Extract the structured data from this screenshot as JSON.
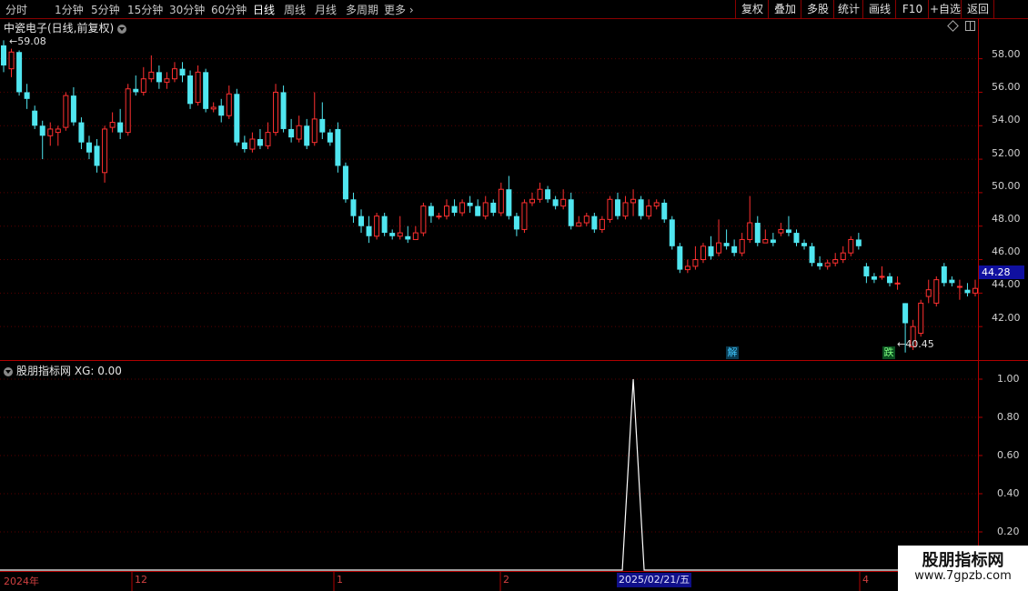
{
  "toolbar": {
    "periods": [
      "分时",
      "1分钟",
      "5分钟",
      "15分钟",
      "30分钟",
      "60分钟",
      "日线",
      "周线",
      "月线",
      "多周期",
      "更多"
    ],
    "active_period": "日线",
    "right_buttons": [
      "复权",
      "叠加",
      "多股",
      "统计",
      "画线",
      "F10",
      "+自选",
      "返回"
    ]
  },
  "main_chart": {
    "title": "中瓷电子(日线,前复权)",
    "high_label": "59.08",
    "low_label": "40.45",
    "last_price": "44.28",
    "y_ticks": [
      "58.00",
      "56.00",
      "54.00",
      "52.00",
      "50.00",
      "48.00",
      "46.00",
      "44.00",
      "42.00"
    ],
    "signals": [
      {
        "text": "解",
        "color": "#40c8ff"
      },
      {
        "text": "跌",
        "color": "#40ff80"
      }
    ]
  },
  "indicator": {
    "title": "股朋指标网",
    "value_text": "XG: 0.00",
    "y_ticks": [
      "1.00",
      "0.80",
      "0.60",
      "0.40",
      "0.20"
    ]
  },
  "x_axis": {
    "labels": [
      "2024年",
      "12",
      "1",
      "2",
      "4"
    ],
    "cursor_date": "2025/02/21/五"
  },
  "watermark": {
    "line1": "股朋指标网",
    "line2": "www.7gpzb.com"
  },
  "colors": {
    "up": "#ff3030",
    "down": "#50e6f0",
    "grid": "#5a0000",
    "border": "#b00000"
  },
  "chart_data": {
    "type": "candlestick",
    "ylim": [
      40,
      59.5
    ],
    "candles": [
      [
        58.8,
        57.6,
        59.1,
        57.2
      ],
      [
        57.4,
        58.4,
        58.6,
        56.9
      ],
      [
        58.4,
        56.0,
        58.5,
        55.8
      ],
      [
        56.0,
        55.6,
        56.5,
        55.0
      ],
      [
        54.9,
        54.0,
        55.2,
        53.8
      ],
      [
        54.0,
        53.4,
        54.3,
        52.0
      ],
      [
        53.4,
        53.8,
        54.2,
        52.8
      ],
      [
        53.6,
        53.8,
        54.0,
        52.8
      ],
      [
        53.9,
        55.8,
        56.0,
        53.7
      ],
      [
        55.8,
        54.2,
        56.3,
        54.0
      ],
      [
        54.2,
        53.0,
        54.5,
        52.6
      ],
      [
        53.0,
        52.4,
        53.4,
        52.0
      ],
      [
        52.8,
        51.6,
        53.2,
        51.2
      ],
      [
        51.2,
        53.8,
        54.0,
        50.6
      ],
      [
        53.9,
        54.2,
        54.8,
        53.6
      ],
      [
        54.2,
        53.6,
        55.0,
        53.2
      ],
      [
        53.6,
        56.2,
        56.5,
        53.4
      ],
      [
        56.2,
        56.0,
        57.0,
        55.8
      ],
      [
        56.0,
        56.8,
        57.5,
        55.8
      ],
      [
        56.8,
        57.2,
        58.2,
        56.6
      ],
      [
        57.2,
        56.6,
        57.6,
        56.2
      ],
      [
        56.6,
        56.8,
        57.2,
        56.2
      ],
      [
        56.8,
        57.4,
        57.8,
        56.6
      ],
      [
        57.4,
        57.0,
        57.8,
        56.6
      ],
      [
        57.0,
        55.3,
        57.3,
        55.0
      ],
      [
        55.4,
        57.2,
        57.6,
        55.2
      ],
      [
        57.2,
        55.0,
        57.4,
        54.8
      ],
      [
        55.0,
        55.1,
        55.4,
        54.8
      ],
      [
        55.2,
        54.6,
        55.6,
        54.2
      ],
      [
        54.6,
        55.9,
        56.4,
        54.4
      ],
      [
        55.9,
        53.0,
        56.2,
        52.8
      ],
      [
        53.0,
        52.6,
        53.4,
        52.4
      ],
      [
        52.6,
        53.2,
        53.6,
        52.4
      ],
      [
        53.2,
        52.8,
        53.8,
        52.6
      ],
      [
        52.8,
        53.6,
        54.2,
        52.6
      ],
      [
        53.6,
        56.0,
        56.5,
        53.4
      ],
      [
        56.0,
        53.8,
        56.4,
        53.6
      ],
      [
        53.8,
        53.3,
        54.4,
        53.0
      ],
      [
        53.2,
        54.0,
        54.6,
        53.0
      ],
      [
        54.0,
        52.8,
        54.4,
        52.6
      ],
      [
        53.0,
        54.4,
        56.0,
        52.8
      ],
      [
        54.4,
        53.6,
        55.4,
        53.2
      ],
      [
        53.6,
        53.0,
        53.8,
        52.8
      ],
      [
        53.8,
        51.6,
        54.2,
        51.2
      ],
      [
        51.6,
        49.6,
        51.8,
        49.4
      ],
      [
        49.6,
        48.6,
        50.0,
        48.2
      ],
      [
        48.6,
        48.0,
        49.0,
        47.6
      ],
      [
        48.0,
        47.4,
        48.6,
        47.0
      ],
      [
        47.4,
        48.6,
        48.8,
        47.2
      ],
      [
        48.6,
        47.6,
        48.8,
        47.4
      ],
      [
        47.6,
        47.4,
        47.8,
        47.2
      ],
      [
        47.4,
        47.6,
        48.6,
        47.2
      ],
      [
        47.4,
        47.2,
        48.0,
        47.0
      ],
      [
        47.2,
        47.6,
        48.0,
        47.2
      ],
      [
        47.6,
        49.2,
        49.4,
        47.4
      ],
      [
        49.2,
        48.6,
        49.4,
        48.2
      ],
      [
        48.6,
        48.6,
        48.8,
        48.4
      ],
      [
        48.6,
        49.2,
        49.6,
        48.4
      ],
      [
        49.2,
        48.8,
        49.6,
        48.6
      ],
      [
        48.8,
        49.4,
        49.6,
        48.6
      ],
      [
        49.4,
        49.2,
        49.8,
        48.8
      ],
      [
        49.2,
        48.6,
        49.6,
        48.6
      ],
      [
        48.6,
        49.4,
        49.8,
        48.4
      ],
      [
        49.4,
        48.8,
        49.6,
        48.6
      ],
      [
        48.8,
        50.2,
        50.6,
        48.6
      ],
      [
        50.2,
        48.6,
        51.0,
        48.4
      ],
      [
        48.6,
        47.8,
        48.8,
        47.4
      ],
      [
        47.8,
        49.4,
        49.6,
        47.6
      ],
      [
        49.4,
        49.6,
        50.0,
        49.2
      ],
      [
        49.6,
        50.2,
        50.6,
        49.4
      ],
      [
        50.2,
        49.6,
        50.4,
        49.4
      ],
      [
        49.6,
        49.2,
        49.8,
        49.0
      ],
      [
        49.2,
        49.6,
        50.2,
        49.0
      ],
      [
        49.6,
        48.0,
        50.0,
        47.8
      ],
      [
        48.0,
        48.2,
        48.6,
        48.0
      ],
      [
        48.2,
        48.6,
        48.8,
        48.0
      ],
      [
        48.6,
        47.8,
        48.8,
        47.6
      ],
      [
        47.8,
        48.4,
        48.6,
        47.6
      ],
      [
        48.4,
        49.6,
        49.8,
        48.2
      ],
      [
        49.6,
        48.6,
        50.0,
        48.4
      ],
      [
        48.6,
        49.4,
        49.8,
        48.4
      ],
      [
        49.4,
        49.6,
        50.2,
        48.6
      ],
      [
        49.6,
        48.6,
        49.8,
        48.4
      ],
      [
        48.6,
        49.2,
        49.6,
        48.4
      ],
      [
        49.2,
        49.4,
        49.6,
        49.0
      ],
      [
        49.4,
        48.4,
        49.6,
        48.2
      ],
      [
        48.4,
        46.8,
        48.6,
        46.6
      ],
      [
        46.8,
        45.4,
        47.0,
        45.2
      ],
      [
        45.4,
        45.6,
        46.0,
        45.2
      ],
      [
        45.6,
        46.0,
        46.8,
        45.4
      ],
      [
        46.0,
        46.8,
        47.0,
        45.8
      ],
      [
        46.8,
        46.2,
        47.4,
        46.0
      ],
      [
        46.4,
        47.0,
        48.4,
        46.2
      ],
      [
        47.0,
        46.8,
        47.8,
        46.6
      ],
      [
        46.8,
        46.4,
        47.2,
        46.2
      ],
      [
        46.4,
        47.2,
        47.6,
        46.2
      ],
      [
        47.2,
        48.2,
        49.8,
        47.0
      ],
      [
        48.2,
        47.0,
        48.6,
        46.8
      ],
      [
        47.0,
        47.2,
        47.8,
        47.0
      ],
      [
        47.2,
        47.0,
        47.6,
        46.8
      ],
      [
        47.6,
        47.8,
        48.2,
        47.4
      ],
      [
        47.8,
        47.6,
        48.6,
        47.4
      ],
      [
        47.6,
        47.0,
        47.8,
        46.8
      ],
      [
        47.0,
        46.8,
        47.2,
        46.6
      ],
      [
        46.8,
        45.8,
        47.0,
        45.6
      ],
      [
        45.8,
        45.6,
        46.2,
        45.4
      ],
      [
        45.6,
        45.8,
        46.0,
        45.4
      ],
      [
        45.8,
        46.0,
        46.4,
        45.6
      ],
      [
        46.0,
        46.4,
        46.8,
        45.8
      ],
      [
        46.4,
        47.2,
        47.4,
        46.2
      ],
      [
        47.2,
        46.8,
        47.6,
        46.6
      ],
      [
        45.6,
        45.0,
        45.8,
        44.6
      ],
      [
        45.0,
        44.8,
        45.2,
        44.6
      ],
      [
        45.0,
        45.0,
        45.6,
        44.8
      ],
      [
        45.0,
        44.6,
        45.2,
        44.4
      ],
      [
        44.6,
        44.6,
        45.0,
        44.2
      ],
      [
        43.4,
        42.2,
        43.4,
        40.45
      ],
      [
        40.8,
        42.0,
        42.4,
        40.6
      ],
      [
        41.6,
        43.4,
        43.6,
        41.4
      ],
      [
        43.8,
        44.2,
        44.8,
        43.4
      ],
      [
        43.4,
        44.8,
        45.0,
        43.2
      ],
      [
        45.6,
        44.6,
        45.8,
        44.4
      ],
      [
        44.8,
        44.6,
        45.0,
        44.4
      ],
      [
        44.4,
        44.4,
        44.8,
        43.6
      ],
      [
        44.2,
        44.0,
        44.6,
        43.8
      ],
      [
        44.0,
        44.28,
        44.8,
        43.8
      ]
    ],
    "indicator_series": {
      "name": "XG",
      "spike_index": 81,
      "values_note": "0 everywhere except 1 at spike"
    },
    "indicator_ylim": [
      0,
      1.05
    ]
  }
}
